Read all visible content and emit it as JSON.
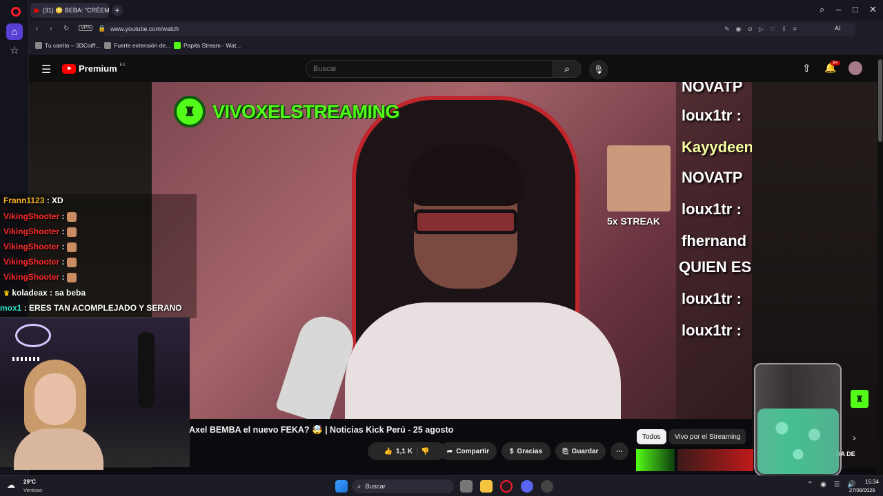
{
  "browser": {
    "tab": {
      "label": "(31) 😳 BEBA: \"CRÉEM"
    },
    "url": "www.youtube.com/watch",
    "vpn_label": "VPN",
    "ai_label": "AI",
    "bookmarks": [
      {
        "label": "Tu carrito – 3DCoiff..."
      },
      {
        "label": "Fuerte extensión de..."
      },
      {
        "label": "Papita Stream - Wat..."
      }
    ]
  },
  "youtube": {
    "logo": "Premium",
    "logo_region": "ES",
    "search_placeholder": "Buscar",
    "notif_count": "9+",
    "video": {
      "overlay_title": "VIVOXELSTREAMING",
      "streak_label": "5x STREAK",
      "video_chat": [
        {
          "text": "NOVATP",
          "color": "#ffffff"
        },
        {
          "text": "loux1tr :",
          "color": "#ffffff"
        },
        {
          "text": "Kayydeen",
          "color": "#f5ffa0"
        },
        {
          "text": "NOVATP",
          "color": "#ffffff"
        },
        {
          "text": "loux1tr :",
          "color": "#ffffff"
        },
        {
          "text": "fhernand",
          "color": "#ffffff"
        },
        {
          "text": "QUIEN ES",
          "color": "#ffffff"
        },
        {
          "text": "loux1tr :",
          "color": "#ffffff"
        },
        {
          "text": "loux1tr :",
          "color": "#ffffff"
        }
      ],
      "title": "Axel BEMBA el nuevo FEKA? 🤯 | Noticias Kick Perú - 25 agosto",
      "like_count": "1,1 K",
      "share_label": "Compartir",
      "thanks_label": "Gracias",
      "save_label": "Guardar"
    },
    "chips": [
      {
        "label": "Todos"
      },
      {
        "label": "Vivo por el Streaming"
      }
    ],
    "thumb_fragment": "DA DE"
  },
  "stream_chat": [
    {
      "user": "Frann1123",
      "msg": ": XD",
      "user_color": "#f5b325",
      "emote": false
    },
    {
      "user": "VikingShooter",
      "msg": ":",
      "user_color": "#ff2a2a",
      "emote": true
    },
    {
      "user": "VikingShooter",
      "msg": ":",
      "user_color": "#ff2a2a",
      "emote": true
    },
    {
      "user": "VikingShooter",
      "msg": ":",
      "user_color": "#ff2a2a",
      "emote": true
    },
    {
      "user": "VikingShooter",
      "msg": ":",
      "user_color": "#ff2a2a",
      "emote": true
    },
    {
      "user": "VikingShooter",
      "msg": ":",
      "user_color": "#ff2a2a",
      "emote": true
    },
    {
      "user": "koladeax",
      "msg": ": sa beba",
      "user_color": "#ffffff",
      "emote": false
    },
    {
      "user": "mox1",
      "msg": ": ERES TAN ACOMPLEJADO Y SERANO",
      "user_color": "#2ee6c8",
      "emote": false
    }
  ],
  "taskbar": {
    "weather_temp": "29°C",
    "weather_desc": "Ventoso",
    "search_label": "Buscar",
    "time": "15:34",
    "date": "27/08/2026"
  },
  "colors": {
    "kick_green": "#53fc18",
    "youtube_red": "#ff0000"
  }
}
